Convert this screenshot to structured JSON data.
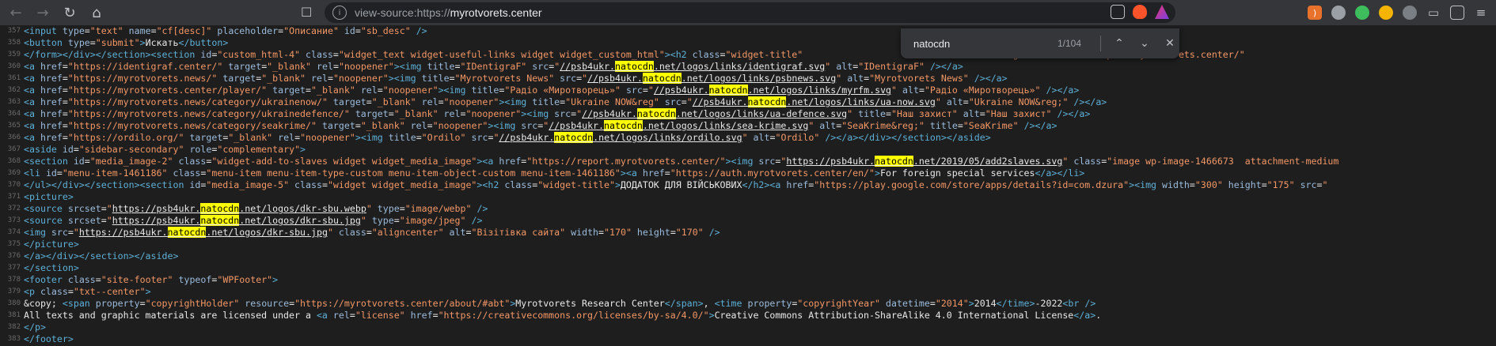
{
  "browser": {
    "url_prefix": "view-source:https://",
    "url_host": "myrotvorets.center",
    "back_icon": "back-arrow-icon",
    "forward_icon": "forward-arrow-icon",
    "reload_icon": "reload-icon",
    "home_icon": "home-icon"
  },
  "find": {
    "query": "natocdn",
    "count": "1/104"
  },
  "lines": [
    {
      "n": "357",
      "html": "<span class=t>&lt;input</span> <span class=a>type</span>=<span class=v>\"text\"</span> <span class=a>name</span>=<span class=v>\"cf[desc]\"</span> <span class=a>placeholder</span>=<span class=v>\"Описание\"</span> <span class=a>id</span>=<span class=v>\"sb_desc\"</span> <span class=t>/&gt;</span>"
    },
    {
      "n": "358",
      "html": "<span class=t>&lt;button</span> <span class=a>type</span>=<span class=v>\"submit\"</span><span class=t>&gt;</span>Искать<span class=t>&lt;/button&gt;</span>"
    },
    {
      "n": "359",
      "html": "<span class=t>&lt;/form&gt;&lt;/div&gt;&lt;/section&gt;&lt;section</span> <span class=a>id</span>=<span class=v>\"custom_html-4\"</span> <span class=a>class</span>=<span class=v>\"widget_text widget-useful-links widget widget_custom_html\"</span><span class=t>&gt;&lt;h2</span> <span class=a>class</span>=<span class=v>\"widget-title\"</span>                              <span class=v>html-widget\"</span><span class=t>&gt;&lt;a</span> <span class=a>href</span>=<span class=v>\"https://myrotvorets.center/\"</span> "
    },
    {
      "n": "360",
      "html": "<span class=t>&lt;a</span> <span class=a>href</span>=<span class=v>\"https://identigraf.center/\"</span> <span class=a>target</span>=<span class=v>\"_blank\"</span> <span class=a>rel</span>=<span class=v>\"noopener\"</span><span class=t>&gt;&lt;img</span> <span class=a>title</span>=<span class=v>\"IDentigraF\"</span> <span class=a>src</span>=<span class=v>\"</span><span class=u>//psb4ukr.<span class=hl>natocdn</span>.net/logos/links/identigraf.svg</span><span class=v>\"</span> <span class=a>alt</span>=<span class=v>\"IDentigraF\"</span> <span class=t>/&gt;&lt;/a&gt;</span>"
    },
    {
      "n": "361",
      "html": "<span class=t>&lt;a</span> <span class=a>href</span>=<span class=v>\"https://myrotvorets.news/\"</span> <span class=a>target</span>=<span class=v>\"_blank\"</span> <span class=a>rel</span>=<span class=v>\"noopener\"</span><span class=t>&gt;&lt;img</span> <span class=a>title</span>=<span class=v>\"Myrotvorets News\"</span> <span class=a>src</span>=<span class=v>\"</span><span class=u>//psb4ukr.<span class=hl>natocdn</span>.net/logos/links/psbnews.svg</span><span class=v>\"</span> <span class=a>alt</span>=<span class=v>\"Myrotvorets News\"</span> <span class=t>/&gt;&lt;/a&gt;</span>"
    },
    {
      "n": "362",
      "html": "<span class=t>&lt;a</span> <span class=a>href</span>=<span class=v>\"https://myrotvorets.center/player/\"</span> <span class=a>target</span>=<span class=v>\"_blank\"</span> <span class=a>rel</span>=<span class=v>\"noopener\"</span><span class=t>&gt;&lt;img</span> <span class=a>title</span>=<span class=v>\"Радіо «Миротворець»\"</span> <span class=a>src</span>=<span class=v>\"</span><span class=u>//psb4ukr.<span class=hl>natocdn</span>.net/logos/links/myrfm.svg</span><span class=v>\"</span> <span class=a>alt</span>=<span class=v>\"Радіо «Миротворець»\"</span> <span class=t>/&gt;&lt;/a&gt;</span>"
    },
    {
      "n": "363",
      "html": "<span class=t>&lt;a</span> <span class=a>href</span>=<span class=v>\"https://myrotvorets.news/category/ukrainenow/\"</span> <span class=a>target</span>=<span class=v>\"_blank\"</span> <span class=a>rel</span>=<span class=v>\"noopener\"</span><span class=t>&gt;&lt;img</span> <span class=a>title</span>=<span class=v>\"Ukraine NOW&amp;reg\"</span> <span class=a>src</span>=<span class=v>\"</span><span class=u>//psb4ukr.<span class=hl>natocdn</span>.net/logos/links/ua-now.svg</span><span class=v>\"</span> <span class=a>alt</span>=<span class=v>\"Ukraine NOW&amp;reg;\"</span> <span class=t>/&gt;&lt;/a&gt;</span>"
    },
    {
      "n": "364",
      "html": "<span class=t>&lt;a</span> <span class=a>href</span>=<span class=v>\"https://myrotvorets.news/category/ukrainedefence/\"</span> <span class=a>target</span>=<span class=v>\"_blank\"</span> <span class=a>rel</span>=<span class=v>\"noopener\"</span><span class=t>&gt;&lt;img</span> <span class=a>src</span>=<span class=v>\"</span><span class=u>//psb4ukr.<span class=hl>natocdn</span>.net/logos/links/ua-defence.svg</span><span class=v>\"</span> <span class=a>title</span>=<span class=v>\"Наш захист\"</span> <span class=a>alt</span>=<span class=v>\"Наш захист\"</span> <span class=t>/&gt;&lt;/a&gt;</span>"
    },
    {
      "n": "365",
      "html": "<span class=t>&lt;a</span> <span class=a>href</span>=<span class=v>\"https://myrotvorets.news/category/seakrime/\"</span> <span class=a>target</span>=<span class=v>\"_blank\"</span> <span class=a>rel</span>=<span class=v>\"noopener\"</span><span class=t>&gt;&lt;img</span> <span class=a>src</span>=<span class=v>\"</span><span class=u>//psb4ukr.<span class=hl>natocdn</span>.net/logos/links/sea-krime.svg</span><span class=v>\"</span> <span class=a>alt</span>=<span class=v>\"SeaKrime&amp;reg;\"</span> <span class=a>title</span>=<span class=v>\"SeaKrime\"</span> <span class=t>/&gt;&lt;/a&gt;</span>"
    },
    {
      "n": "366",
      "html": "<span class=t>&lt;a</span> <span class=a>href</span>=<span class=v>\"https://ordilo.org/\"</span> <span class=a>target</span>=<span class=v>\"_blank\"</span> <span class=a>rel</span>=<span class=v>\"noopener\"</span><span class=t>&gt;&lt;img</span> <span class=a>title</span>=<span class=v>\"Ordilo\"</span> <span class=a>src</span>=<span class=v>\"</span><span class=u>//psb4ukr.<span class=hl>natocdn</span>.net/logos/links/ordilo.svg</span><span class=v>\"</span> <span class=a>alt</span>=<span class=v>\"Ordilo\"</span> <span class=t>/&gt;&lt;/a&gt;&lt;/div&gt;&lt;/section&gt;&lt;/aside&gt;</span>"
    },
    {
      "n": "367",
      "html": "<span class=t>&lt;aside</span> <span class=a>id</span>=<span class=v>\"sidebar-secondary\"</span> <span class=a>role</span>=<span class=v>\"complementary\"</span><span class=t>&gt;</span>"
    },
    {
      "n": "368",
      "html": "<span class=t>&lt;section</span> <span class=a>id</span>=<span class=v>\"media_image-2\"</span> <span class=a>class</span>=<span class=v>\"widget-add-to-slaves widget widget_media_image\"</span><span class=t>&gt;&lt;a</span> <span class=a>href</span>=<span class=v>\"https://report.myrotvorets.center/\"</span><span class=t>&gt;&lt;img</span> <span class=a>src</span>=<span class=v>\"</span><span class=u>https://psb4ukr.<span class=hl>natocdn</span>.net/2019/05/add2slaves.svg</span><span class=v>\"</span> <span class=a>class</span>=<span class=v>\"image wp-image-1466673  attachment-medium</span>"
    },
    {
      "n": "369",
      "html": "<span class=t>&lt;li</span> <span class=a>id</span>=<span class=v>\"menu-item-1461186\"</span> <span class=a>class</span>=<span class=v>\"menu-item menu-item-type-custom menu-item-object-custom menu-item-1461186\"</span><span class=t>&gt;&lt;a</span> <span class=a>href</span>=<span class=v>\"https://auth.myrotvorets.center/en/\"</span><span class=t>&gt;</span>For foreign special services<span class=t>&lt;/a&gt;&lt;/li&gt;</span>"
    },
    {
      "n": "370",
      "html": "<span class=t>&lt;/ul&gt;&lt;/div&gt;&lt;/section&gt;&lt;section</span> <span class=a>id</span>=<span class=v>\"media_image-5\"</span> <span class=a>class</span>=<span class=v>\"widget widget_media_image\"</span><span class=t>&gt;&lt;h2</span> <span class=a>class</span>=<span class=v>\"widget-title\"</span><span class=t>&gt;</span>ДОДАТОК ДЛЯ ВІЙСЬКОВИХ<span class=t>&lt;/h2&gt;&lt;a</span> <span class=a>href</span>=<span class=v>\"https://play.google.com/store/apps/details?id=com.dzura\"</span><span class=t>&gt;&lt;img</span> <span class=a>width</span>=<span class=v>\"300\"</span> <span class=a>height</span>=<span class=v>\"175\"</span> <span class=a>src</span>=<span class=v>\"</span>"
    },
    {
      "n": "371",
      "html": "<span class=t>&lt;picture&gt;</span>"
    },
    {
      "n": "372",
      "html": "<span class=t>&lt;source</span> <span class=a>srcset</span>=<span class=v>\"</span><span class=u>https://psb4ukr.<span class=hl>natocdn</span>.net/logos/dkr-sbu.webp</span><span class=v>\"</span> <span class=a>type</span>=<span class=v>\"image/webp\"</span> <span class=t>/&gt;</span>"
    },
    {
      "n": "373",
      "html": "<span class=t>&lt;source</span> <span class=a>srcset</span>=<span class=v>\"</span><span class=u>https://psb4ukr.<span class=hl>natocdn</span>.net/logos/dkr-sbu.jpg</span><span class=v>\"</span> <span class=a>type</span>=<span class=v>\"image/jpeg\"</span> <span class=t>/&gt;</span>"
    },
    {
      "n": "374",
      "html": "<span class=t>&lt;img</span> <span class=a>src</span>=<span class=v>\"</span><span class=u>https://psb4ukr.<span class=hl>natocdn</span>.net/logos/dkr-sbu.jpg</span><span class=v>\"</span> <span class=a>class</span>=<span class=v>\"aligncenter\"</span> <span class=a>alt</span>=<span class=v>\"Візітівка сайта\"</span> <span class=a>width</span>=<span class=v>\"170\"</span> <span class=a>height</span>=<span class=v>\"170\"</span> <span class=t>/&gt;</span>"
    },
    {
      "n": "375",
      "html": "<span class=t>&lt;/picture&gt;</span>"
    },
    {
      "n": "376",
      "html": "<span class=t>&lt;/a&gt;&lt;/div&gt;&lt;/section&gt;&lt;/aside&gt;</span>"
    },
    {
      "n": "377",
      "html": "<span class=t>&lt;/section&gt;</span>"
    },
    {
      "n": "378",
      "html": "<span class=t>&lt;footer</span> <span class=a>class</span>=<span class=v>\"site-footer\"</span> <span class=a>typeof</span>=<span class=v>\"WPFooter\"</span><span class=t>&gt;</span>"
    },
    {
      "n": "379",
      "html": "<span class=t>&lt;p</span> <span class=a>class</span>=<span class=v>\"txt--center\"</span><span class=t>&gt;</span>"
    },
    {
      "n": "380",
      "html": "&amp;copy; <span class=t>&lt;span</span> <span class=a>property</span>=<span class=v>\"copyrightHolder\"</span> <span class=a>resource</span>=<span class=v>\"https://myrotvorets.center/about/#abt\"</span><span class=t>&gt;</span>Myrotvorets Research Center<span class=t>&lt;/span&gt;</span>, <span class=t>&lt;time</span> <span class=a>property</span>=<span class=v>\"copyrightYear\"</span> <span class=a>datetime</span>=<span class=v>\"2014\"</span><span class=t>&gt;</span>2014<span class=t>&lt;/time&gt;</span>-2022<span class=t>&lt;br /&gt;</span>"
    },
    {
      "n": "381",
      "html": "All texts and graphic materials are licensed under a <span class=t>&lt;a</span> <span class=a>rel</span>=<span class=v>\"license\"</span> <span class=a>href</span>=<span class=v>\"https://creativecommons.org/licenses/by-sa/4.0/\"</span><span class=t>&gt;</span>Creative Commons Attribution-ShareAlike 4.0 International License<span class=t>&lt;/a&gt;</span>."
    },
    {
      "n": "382",
      "html": "<span class=t>&lt;/p&gt;</span>"
    },
    {
      "n": "383",
      "html": "<span class=t>&lt;/footer&gt;</span>"
    }
  ]
}
